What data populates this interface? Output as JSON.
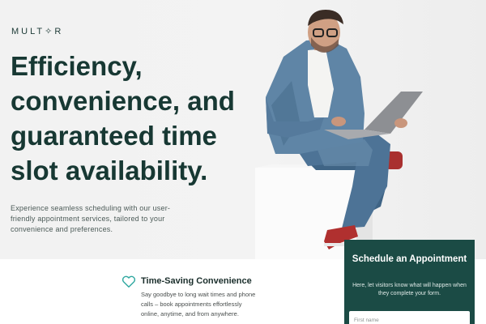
{
  "brand": {
    "logo": "MULT✧R"
  },
  "hero": {
    "headline": "Efficiency, convenience, and guaranteed time slot availability.",
    "subtext": "Experience seamless scheduling with our user-friendly appointment services, tailored to your convenience and preferences."
  },
  "feature": {
    "icon": "heart-icon",
    "title": "Time-Saving Convenience",
    "text": "Say goodbye to long wait times and phone calls – book appointments effortlessly online, anytime, and from anywhere."
  },
  "schedule_panel": {
    "title": "Schedule an Appointment",
    "subtitle": "Here, let visitors know what will happen when they complete your form.",
    "first_name_placeholder": "First name"
  },
  "colors": {
    "brand_dark": "#173833",
    "panel_bg": "#1b4b45",
    "accent_teal": "#2fa8a0"
  }
}
